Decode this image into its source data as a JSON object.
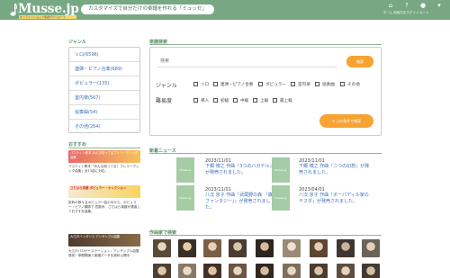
{
  "header": {
    "logo_text": "Musse.jp",
    "logo_sub": "オンラインショップ楽譜ダウンロード",
    "tagline": "カスタマイズで自分だけの楽譜を作れる「ミュッセ」",
    "icons": [
      "home-icon",
      "info-icon",
      "user-icon",
      "cart-icon"
    ],
    "icon_labels": "ホーム 利用方法 ログイン カート"
  },
  "sidebar": {
    "genre_title": "ジャンル",
    "genres": [
      "ソロ(6596)",
      "連弾・ピアノ合奏(689)",
      "ポピュラー(135)",
      "室内楽(567)",
      "協奏曲(54)",
      "その他(264)"
    ],
    "recommend_title": "おすすめ",
    "recommends": [
      {
        "banner": "パスティン教本 みんな知ってるプレリーディング曲集",
        "text": "バスティン教本「みんな知ってる！プレリーディング曲集」全13曲に対応。"
      },
      {
        "banner": "さだはら楽譜 ポピュラー・セレクション",
        "text": "抜粋の数々るポピュラー曲の中から、ポピュラー・ピアノ講師で 佐藤歩、さだはら楽譜が選曲しておすすめ曲集。"
      },
      {
        "banner": "大江戸バンダンス アンサンブル曲集",
        "text": "大江戸バロゲーステーション：アンサンブル曲集発売！単間開演で楽譜データを無料公開中"
      }
    ]
  },
  "search": {
    "title": "楽譜検索",
    "placeholder": "検索",
    "button": "検索",
    "genre_label": "ジャンル",
    "genre_options": [
      "ソロ",
      "連弾・ピアノ合奏",
      "ポピュラー",
      "室内楽",
      "協奏曲",
      "その他"
    ],
    "level_label": "難易度",
    "level_options": [
      "導入",
      "初級",
      "中級",
      "上級",
      "最上級"
    ],
    "advanced_button": "上の条件で検索"
  },
  "news": {
    "title": "新着ニュース",
    "thumb_label": "Musse.jp",
    "items": [
      {
        "date": "2023/11/01",
        "text": "下郷 博之 作曲『3つのバガテル』が発売されました。"
      },
      {
        "date": "2023/11/01",
        "text": "下郷 博之 作曲『二つの幻想』が発売されました。"
      },
      {
        "date": "2023/11/01",
        "text": "八汉 京子 作曲『武蔵野の森 「森のファンタジー」』が発売されました。"
      },
      {
        "date": "2023/04/01",
        "text": "八汉 京子 作曲『ポーパディル家のテスダ』が発売されました。"
      }
    ]
  },
  "composers": {
    "title": "作曲家で検索"
  }
}
